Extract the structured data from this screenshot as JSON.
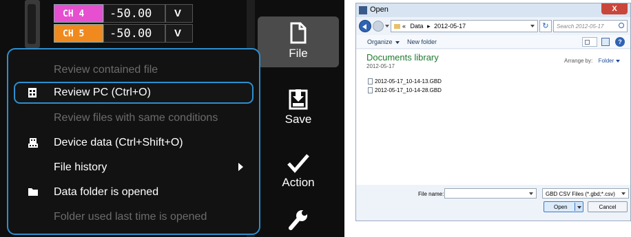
{
  "left": {
    "channels": [
      {
        "name": "CH 4",
        "value": "-50.00",
        "unit": "V",
        "color": "#e64fd0"
      },
      {
        "name": "CH 5",
        "value": "-50.00",
        "unit": "V",
        "color": "#f08a1e"
      }
    ],
    "toolbar": {
      "file_label": "File",
      "save_label": "Save",
      "action_label": "Action"
    },
    "menu": {
      "items": [
        {
          "label": "Review contained file",
          "enabled": false
        },
        {
          "label": "Review PC (Ctrl+O)",
          "enabled": true,
          "highlight": true,
          "icon": "document-icon"
        },
        {
          "label": "Review files with same conditions",
          "enabled": false
        },
        {
          "label": "Device data (Ctrl+Shift+O)",
          "enabled": true,
          "icon": "device-icon"
        },
        {
          "label": "File history",
          "enabled": true,
          "submenu": true
        },
        {
          "label": "Data folder is opened",
          "enabled": true,
          "icon": "folder-icon"
        },
        {
          "label": "Folder used last time is opened",
          "enabled": false
        }
      ]
    },
    "colors": {
      "accent": "#2d8fd0",
      "disabled_text": "#6c6c6c"
    }
  },
  "dialog": {
    "title": "Open",
    "close_label": "X",
    "address": {
      "prefix": "«",
      "crumbs": [
        "Data",
        "2012-05-17"
      ]
    },
    "search_placeholder": "Search 2012-05-17",
    "organize_label": "Organize",
    "new_folder_label": "New folder",
    "help_label": "?",
    "library_title": "Documents library",
    "library_subtitle": "2012-05-17",
    "arrange_by_label": "Arrange by:",
    "arrange_by_value": "Folder",
    "files": [
      "2012-05-17_10-14-13.GBD",
      "2012-05-17_10-14-28.GBD"
    ],
    "filename_label": "File name:",
    "filename_value": "",
    "filetype_value": "GBD CSV Files (*.gbd;*.csv)",
    "open_label": "Open",
    "cancel_label": "Cancel"
  }
}
